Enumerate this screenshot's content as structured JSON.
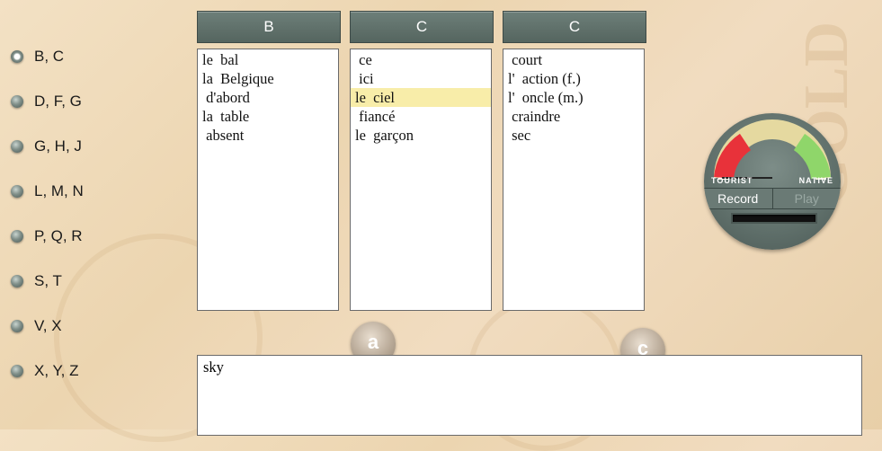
{
  "letter_groups": [
    {
      "label": "B, C",
      "selected": true
    },
    {
      "label": "D, F, G",
      "selected": false
    },
    {
      "label": "G, H, J",
      "selected": false
    },
    {
      "label": "L, M, N",
      "selected": false
    },
    {
      "label": "P, Q, R",
      "selected": false
    },
    {
      "label": "S, T",
      "selected": false
    },
    {
      "label": "V, X",
      "selected": false
    },
    {
      "label": "X, Y, Z",
      "selected": false
    }
  ],
  "columns": [
    {
      "header": "B",
      "words": [
        "le  bal",
        "la  Belgique",
        " d'abord",
        "la  table",
        " absent"
      ],
      "selected_index": -1
    },
    {
      "header": "C",
      "words": [
        " ce",
        " ici",
        "le  ciel",
        " fiancé",
        "le  garçon"
      ],
      "selected_index": 2
    },
    {
      "header": "C",
      "words": [
        " court",
        "l'  action (f.)",
        "l'  oncle (m.)",
        " craindre",
        " sec"
      ],
      "selected_index": -1
    }
  ],
  "round_buttons": {
    "left": "a",
    "right": "c"
  },
  "translation": "sky",
  "meter": {
    "left_label": "TOURIST",
    "right_label": "NATIVE",
    "record_label": "Record",
    "play_label": "Play",
    "colors": {
      "red": "#e8323a",
      "green": "#8fd66a",
      "arc": "#e5d9a0"
    }
  }
}
